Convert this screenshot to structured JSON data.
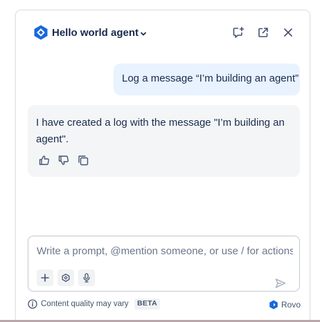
{
  "header": {
    "title": "Hello world agent",
    "icons": {
      "logo": "agent-logo-icon",
      "dropdown": "chevron-down-icon",
      "new_chat": "new-chat-icon",
      "open": "open-external-icon",
      "close": "close-icon"
    }
  },
  "conversation": {
    "user_message": "Log a message “I’m building an agent”",
    "agent_message": "I have created a log with the message \"I’m building an agent\".",
    "reactions": [
      "thumbs-up-icon",
      "thumbs-down-icon",
      "copy-icon"
    ]
  },
  "composer": {
    "placeholder": "Write a prompt, @mention someone, or use / for actions",
    "value": "",
    "tools": [
      "plus-icon",
      "agent-icon",
      "microphone-icon"
    ],
    "send": "send-icon"
  },
  "footer": {
    "notice": "Content quality may vary",
    "badge": "BETA",
    "brand": "Rovo"
  },
  "colors": {
    "accent": "#1868db",
    "user_bubble": "#e9f2ff",
    "agent_bubble": "#f4f5f7",
    "text": "#172b4d",
    "muted": "#44546f"
  }
}
